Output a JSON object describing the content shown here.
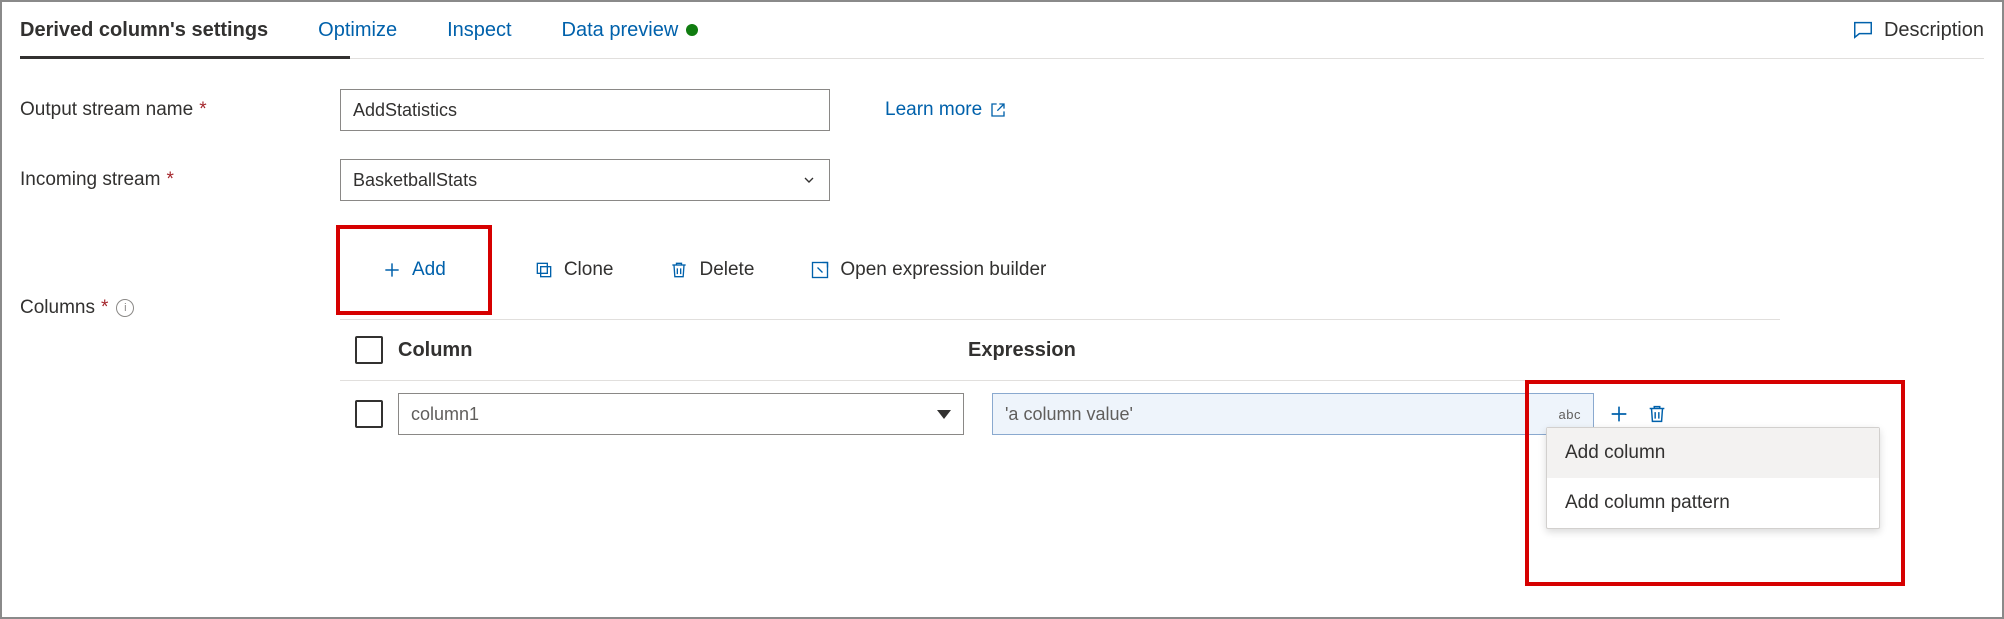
{
  "tabs": {
    "active": "Derived column's settings",
    "optimize": "Optimize",
    "inspect": "Inspect",
    "preview": "Data preview"
  },
  "description_label": "Description",
  "form": {
    "output_label": "Output stream name",
    "output_value": "AddStatistics",
    "incoming_label": "Incoming stream",
    "incoming_value": "BasketballStats",
    "columns_label": "Columns",
    "learn_more": "Learn more"
  },
  "toolbar": {
    "add": "Add",
    "clone": "Clone",
    "delete": "Delete",
    "open_builder": "Open expression builder"
  },
  "table": {
    "col_header": "Column",
    "expr_header": "Expression",
    "rows": [
      {
        "name_placeholder": "column1",
        "expr_placeholder": "'a column value'",
        "type_badge": "abc"
      }
    ]
  },
  "context_menu": {
    "add_column": "Add column",
    "add_pattern": "Add column pattern"
  }
}
